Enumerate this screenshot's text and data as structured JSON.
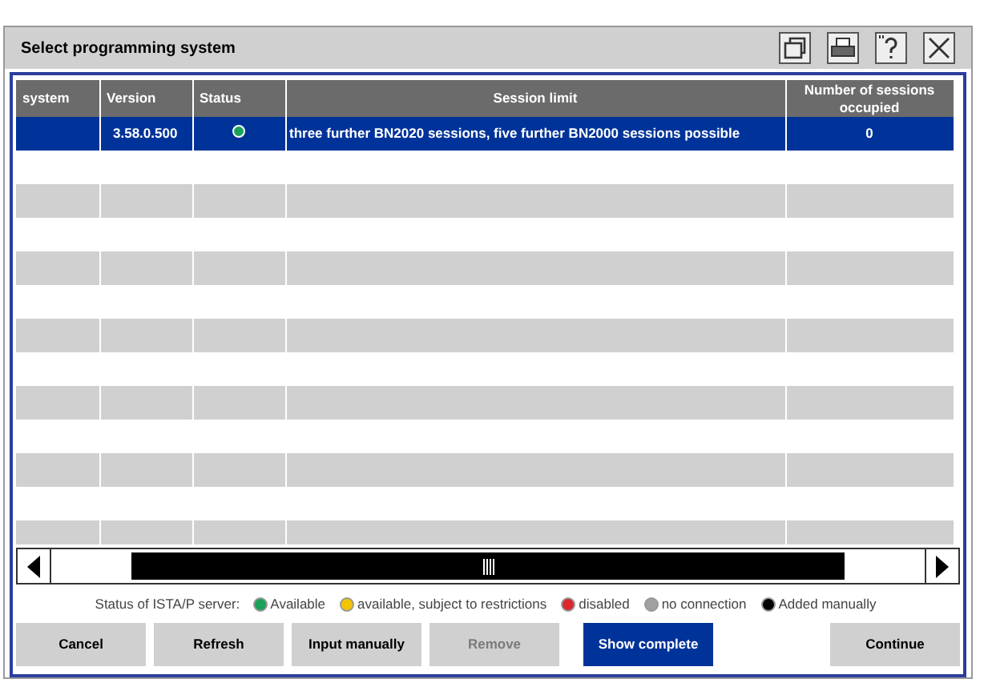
{
  "window": {
    "title": "Select programming system"
  },
  "table": {
    "columns": [
      "system",
      "Version",
      "Status",
      "Session limit",
      "Number of sessions occupied"
    ],
    "rows": [
      {
        "cells": [
          "",
          "3.58.0.500",
          "",
          "three further BN2020 sessions, five further BN2000 sessions possible",
          "0"
        ],
        "color": "#1aa25a",
        "selected": true
      }
    ]
  },
  "legend": {
    "label": "Status of ISTA/P server:",
    "items": [
      {
        "label": "Available",
        "color": "#1aa25a"
      },
      {
        "label": "available, subject to restrictions",
        "color": "#f2c500"
      },
      {
        "label": "disabled",
        "color": "#d9282f"
      },
      {
        "label": "no connection",
        "color": "#a0a0a0"
      },
      {
        "label": "Added manually",
        "color": "#000000"
      }
    ]
  },
  "buttons": [
    {
      "label": "Cancel",
      "disabled": false,
      "primary": false
    },
    {
      "label": "Refresh",
      "disabled": false,
      "primary": false
    },
    {
      "label": "Input manually",
      "disabled": false,
      "primary": false
    },
    {
      "label": "Remove",
      "disabled": true,
      "primary": false
    },
    {
      "label": "Show complete",
      "disabled": false,
      "primary": true
    },
    {
      "label": "Continue",
      "disabled": false,
      "primary": false
    }
  ]
}
